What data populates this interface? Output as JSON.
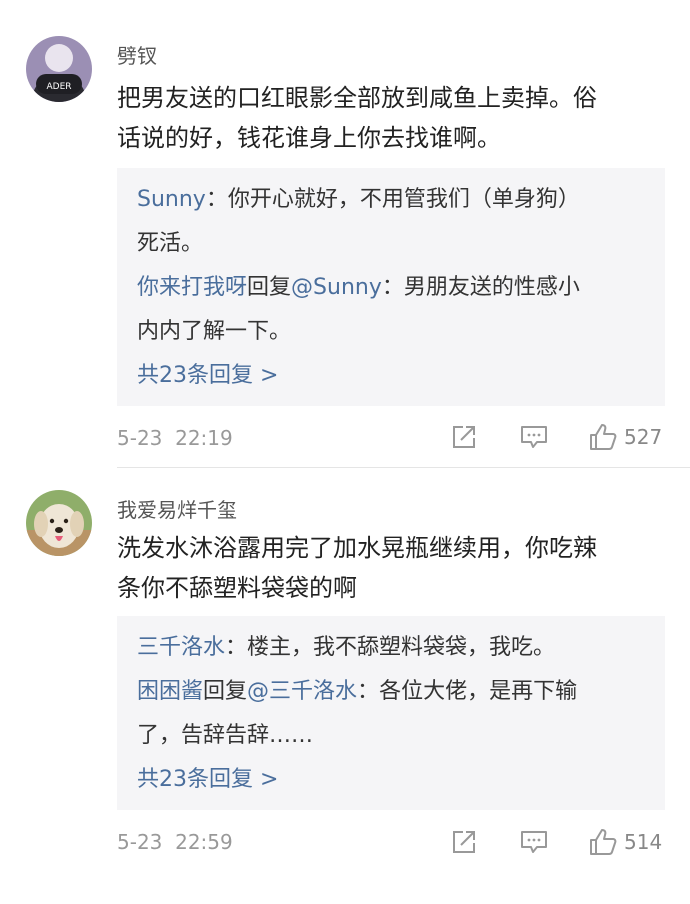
{
  "comments": [
    {
      "username": "劈钗",
      "avatar_label": "ADER",
      "text_line1": "把男友送的口红眼影全部放到咸鱼上卖掉。俗",
      "text_line2": "话说的好，钱花谁身上你去找谁啊。",
      "replies": [
        {
          "author": "Sunny",
          "sep": "：",
          "text_a": "你开心就好，不用管我们（单身狗）",
          "text_b": "死活。"
        },
        {
          "author": "你来打我呀",
          "reply_word": "回复",
          "mention": "@Sunny",
          "sep": "：",
          "text_a": "男朋友送的性感小",
          "text_b": "内内了解一下。"
        }
      ],
      "more_replies": "共23条回复 >",
      "date": "5-23",
      "time": "22:19",
      "likes": "527"
    },
    {
      "username": "我爱易烊千玺",
      "text_line1": "洗发水沐浴露用完了加水晃瓶继续用，你吃辣",
      "text_line2": "条你不舔塑料袋袋的啊",
      "replies": [
        {
          "author": "三千洛水",
          "sep": "：",
          "text_a": "楼主，我不舔塑料袋袋，我吃。"
        },
        {
          "author": "困困酱",
          "reply_word": "回复",
          "mention": "@三千洛水",
          "sep": "：",
          "text_a": "各位大佬，是再下输",
          "text_b": "了，告辞告辞……"
        }
      ],
      "more_replies": "共23条回复 >",
      "date": "5-23",
      "time": "22:59",
      "likes": "514"
    }
  ],
  "icons": {
    "share": "share-icon",
    "comment": "comment-icon",
    "like": "thumbs-up-icon"
  },
  "colors": {
    "link_blue": "#4a6e9c",
    "reply_bg": "#f5f5f7"
  }
}
